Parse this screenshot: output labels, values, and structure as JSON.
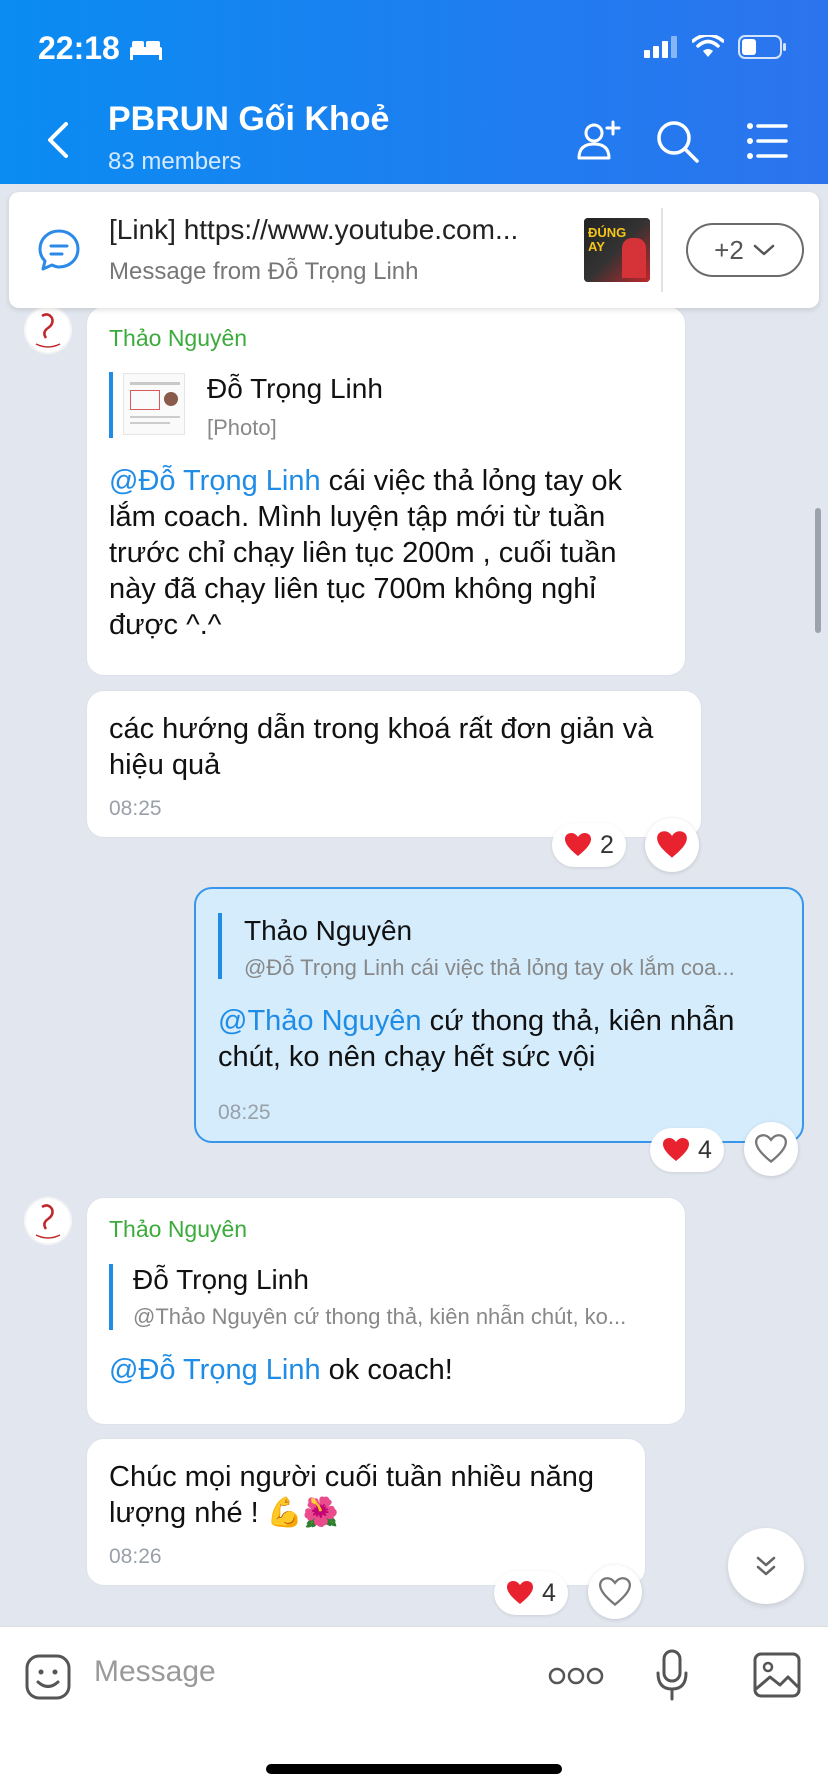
{
  "status": {
    "time": "22:18"
  },
  "header": {
    "title": "PBRUN Gối Khoẻ",
    "subtitle": "83 members"
  },
  "pinned": {
    "title": "[Link] https://www.youtube.com...",
    "subtitle": "Message from Đỗ Trọng Linh",
    "more_label": "+2",
    "thumb_text": "ĐÚNG AY"
  },
  "messages": [
    {
      "sender": "Thảo Nguyên",
      "quote_name": "Đỗ Trọng Linh",
      "quote_text": "[Photo]",
      "mention": "@Đỗ Trọng Linh",
      "text_l1": " cái việc thả lỏng tay ok",
      "text_l2": "lắm coach. Mình luyện tập mới từ tuần",
      "text_l3": "trước chỉ chạy liên tục 200m , cuối tuần",
      "text_l4": "này đã chạy liên tục 700m không nghỉ",
      "text_l5": "được ^.^"
    },
    {
      "text_l1": "các hướng dẫn trong khoá rất đơn giản và",
      "text_l2": "hiệu quả",
      "time": "08:25",
      "reaction_count": "2"
    },
    {
      "quote_name": "Thảo Nguyên",
      "quote_text": "@Đỗ Trọng Linh cái việc thả lỏng tay ok  lắm coa...",
      "mention": "@Thảo Nguyên",
      "text_l1": " cứ thong thả, kiên nhẫn",
      "text_l2": "chút, ko nên chạy hết sức vội",
      "time": "08:25",
      "reaction_count": "4"
    },
    {
      "sender": "Thảo Nguyên",
      "quote_name": "Đỗ Trọng Linh",
      "quote_text": "@Thảo Nguyên cứ thong thả, kiên nhẫn chút, ko...",
      "mention": "@Đỗ Trọng Linh",
      "text_l1": " ok coach!"
    },
    {
      "text_l1": "Chúc mọi người cuối tuần nhiều năng",
      "text_l2": "lượng nhé ! 💪🌺",
      "time": "08:26",
      "reaction_count": "4"
    }
  ],
  "input": {
    "placeholder": "Message"
  },
  "colors": {
    "header": "#1f7df0",
    "mention": "#1f8ce6",
    "sender": "#3bab3b",
    "own_bubble": "#d4ecfc"
  }
}
